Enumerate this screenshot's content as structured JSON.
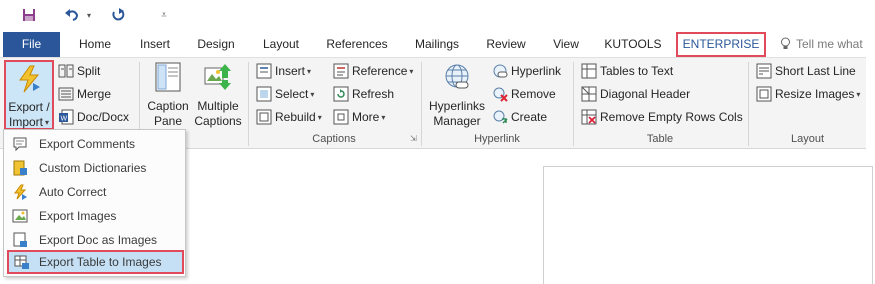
{
  "tabs": {
    "file": "File",
    "home": "Home",
    "insert": "Insert",
    "design": "Design",
    "layout": "Layout",
    "references": "References",
    "mailings": "Mailings",
    "review": "Review",
    "view": "View",
    "kutools": "KUTOOLS",
    "enterprise": "ENTERPRISE",
    "tell_me": "Tell me what"
  },
  "ribbon": {
    "export_import": [
      "Export /",
      "Import"
    ],
    "split": "Split",
    "merge": "Merge",
    "doc_docx": "Doc/Docx",
    "caption_pane": [
      "Caption",
      "Pane"
    ],
    "multiple_captions": [
      "Multiple",
      "Captions"
    ],
    "insert": "Insert",
    "select": "Select",
    "rebuild": "Rebuild",
    "reference": "Reference",
    "refresh": "Refresh",
    "more": "More",
    "captions_group": "Captions",
    "hyperlinks_manager": [
      "Hyperlinks",
      "Manager"
    ],
    "hyperlink": "Hyperlink",
    "remove": "Remove",
    "create": "Create",
    "hyperlink_group": "Hyperlink",
    "tables_to_text": "Tables to Text",
    "diagonal_header": "Diagonal Header",
    "remove_empty": "Remove Empty Rows Cols",
    "table_group": "Table",
    "short_last_line": "Short Last Line",
    "resize_images": "Resize Images",
    "layout_group": "Layout"
  },
  "menu": {
    "items": [
      "Export Comments",
      "Custom Dictionaries",
      "Auto Correct",
      "Export Images",
      "Export Doc as Images",
      "Export Table to Images"
    ]
  }
}
